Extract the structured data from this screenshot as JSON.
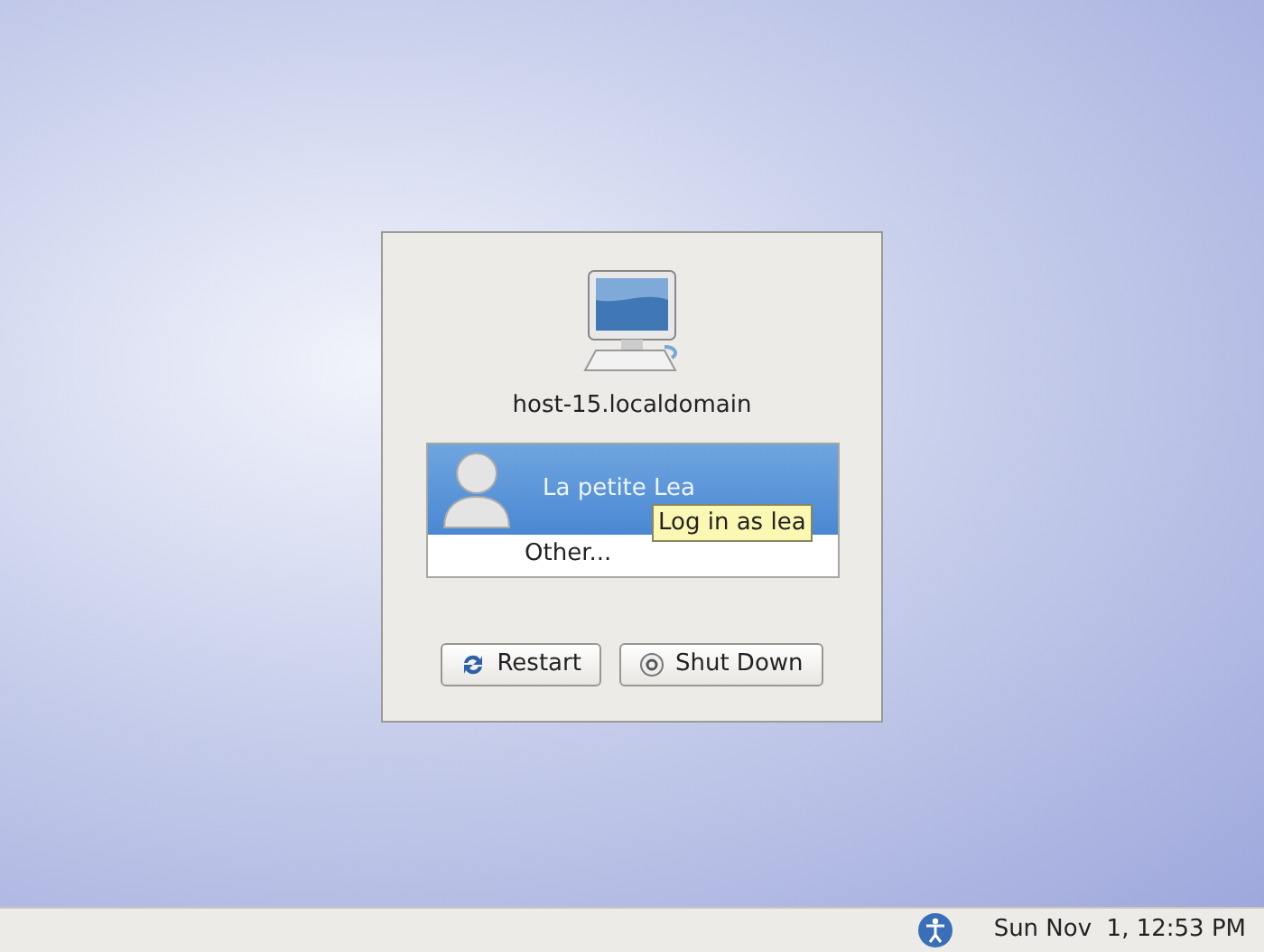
{
  "dialog": {
    "hostname": "host-15.localdomain",
    "users": [
      {
        "kind": "user",
        "label": "La petite Lea",
        "selected": true
      },
      {
        "kind": "other",
        "label": "Other...",
        "selected": false
      }
    ],
    "tooltip": "Log in as lea",
    "buttons": [
      {
        "kind": "restart",
        "label": "Restart"
      },
      {
        "kind": "shutdown",
        "label": "Shut Down"
      }
    ]
  },
  "panel": {
    "clock": "Sun Nov  1, 12:53 PM"
  }
}
